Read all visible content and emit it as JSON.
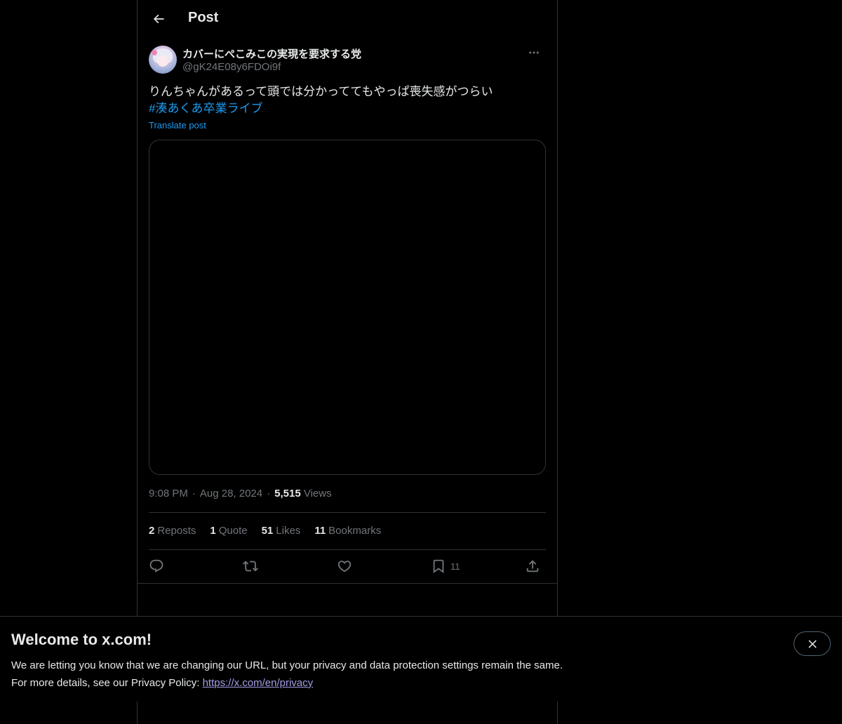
{
  "header": {
    "title": "Post"
  },
  "post": {
    "author_name": "カバーにぺこみこの実現を要求する党",
    "author_handle": "@gK24E08y6FDOi9f",
    "text": "りんちゃんがあるって頭では分かっててもやっぱ喪失感がつらい",
    "hashtag": "#湊あくあ卒業ライブ",
    "translate_label": "Translate post",
    "time": "9:08 PM",
    "date": "Aug 28, 2024",
    "views_count": "5,515",
    "views_label": "Views"
  },
  "stats": {
    "reposts_count": "2",
    "reposts_label": "Reposts",
    "quotes_count": "1",
    "quotes_label": "Quote",
    "likes_count": "51",
    "likes_label": "Likes",
    "bookmarks_count": "11",
    "bookmarks_label": "Bookmarks"
  },
  "actions": {
    "bookmark_count": "11",
    "icons": [
      "reply-icon",
      "repost-icon",
      "like-icon",
      "bookmark-icon",
      "share-icon"
    ]
  },
  "banner": {
    "title": "Welcome to x.com!",
    "line1": "We are letting you know that we are changing our URL, but your privacy and data protection settings remain the same.",
    "line2_prefix": "For more details, see our Privacy Policy: ",
    "link": "https://x.com/en/privacy"
  },
  "colors": {
    "background": "#000000",
    "text": "#e7e9ea",
    "muted": "#71767b",
    "accent": "#1d9bf0",
    "border": "#2f3336",
    "link": "#a29ee6"
  }
}
